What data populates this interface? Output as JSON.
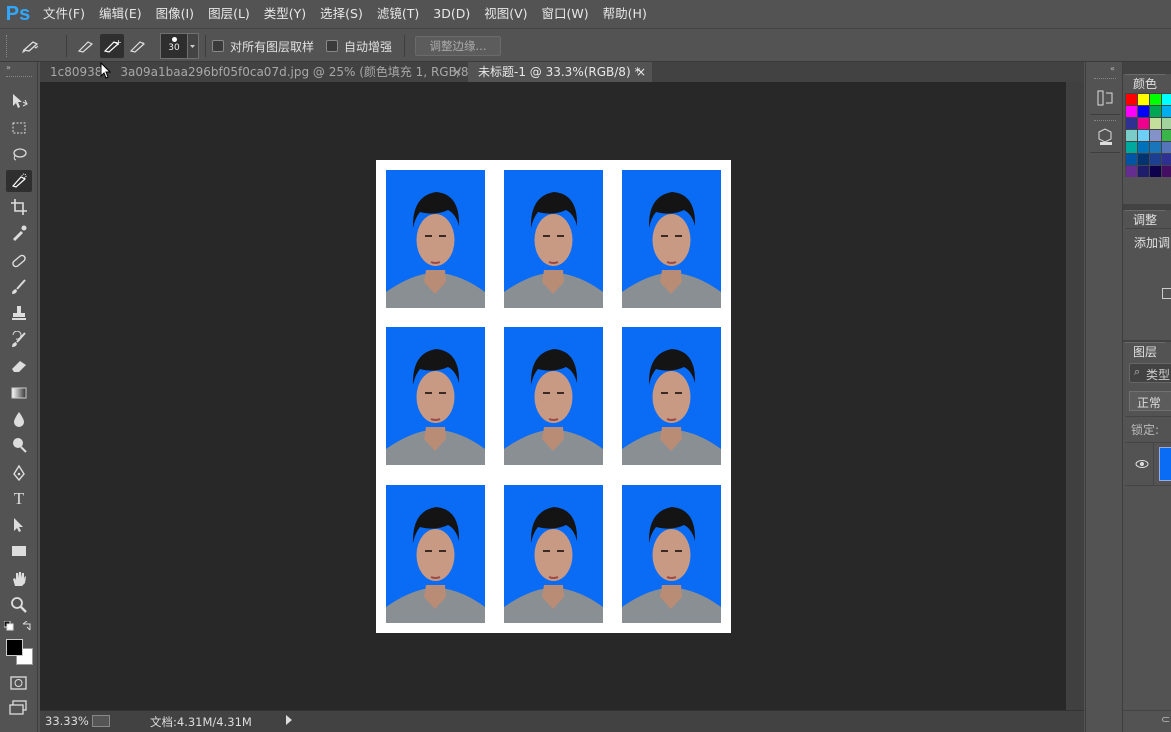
{
  "app": {
    "logo": "Ps",
    "accent": "#31a8ff"
  },
  "menu": [
    "文件(F)",
    "编辑(E)",
    "图像(I)",
    "图层(L)",
    "类型(Y)",
    "选择(S)",
    "滤镜(T)",
    "3D(D)",
    "视图(V)",
    "窗口(W)",
    "帮助(H)"
  ],
  "options": {
    "brush_size": "30",
    "sample_all_layers": "对所有图层取样",
    "auto_enhance": "自动增强",
    "refine_edge": "调整边缘..."
  },
  "tabs": [
    {
      "label": "1c80938",
      "label_rest": "3a09a1baa296bf05f0ca07d.jpg @ 25% (颜色填充 1, RGB/8#) *",
      "close": "×"
    },
    {
      "label": "未标题-1 @ 33.3%(RGB/8) *",
      "close": "×"
    }
  ],
  "status": {
    "zoom": "33.33%",
    "doc_info": "文档:4.31M/4.31M"
  },
  "panels": {
    "color_tab": "颜色",
    "adjust_tab": "调整",
    "adjust_add": "添加调",
    "layers_tab": "图层",
    "layers_search": "类型",
    "blend_mode": "正常",
    "lock": "锁定:"
  },
  "photo_bg": "#0a6bf5",
  "photo_count": 9,
  "icons": {
    "tools": [
      "move-icon",
      "marquee-icon",
      "lasso-icon",
      "quick-select-icon",
      "crop-icon",
      "eyedropper-icon",
      "healing-icon",
      "brush-icon",
      "stamp-icon",
      "history-brush-icon",
      "eraser-icon",
      "gradient-icon",
      "blur-icon",
      "dodge-icon",
      "pen-icon",
      "type-icon",
      "path-select-icon",
      "rectangle-icon",
      "hand-icon",
      "zoom-icon"
    ]
  }
}
